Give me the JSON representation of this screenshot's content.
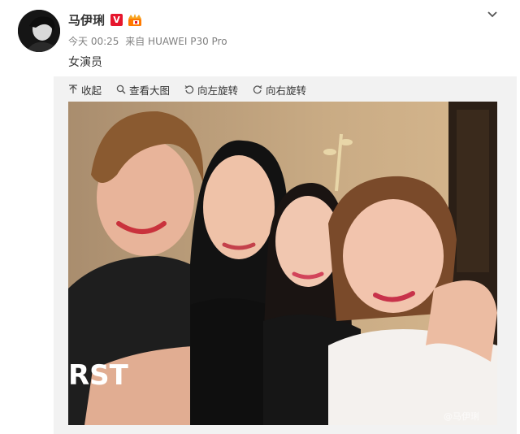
{
  "post": {
    "author": {
      "name": "马伊琍",
      "verified_badge": "V",
      "avatar_icon": "avatar-photo",
      "level_badge_icon": "member-crown-icon"
    },
    "meta": {
      "time": "今天 00:25",
      "source": "来自 HUAWEI P30 Pro"
    },
    "text": "女演员",
    "dropdown_icon": "chevron-down-icon"
  },
  "media_toolbar": {
    "items": [
      {
        "label": "收起",
        "icon": "collapse-icon"
      },
      {
        "label": "查看大图",
        "icon": "search-icon"
      },
      {
        "label": "向左旋转",
        "icon": "rotate-left-icon"
      },
      {
        "label": "向右旋转",
        "icon": "rotate-right-icon"
      }
    ]
  },
  "photo": {
    "description_icon": "group-selfie-photo",
    "watermark": "@马伊琍"
  },
  "colors": {
    "verified_red": "#e6162d",
    "meta_gray": "#808080",
    "panel_bg": "#f2f2f2"
  }
}
